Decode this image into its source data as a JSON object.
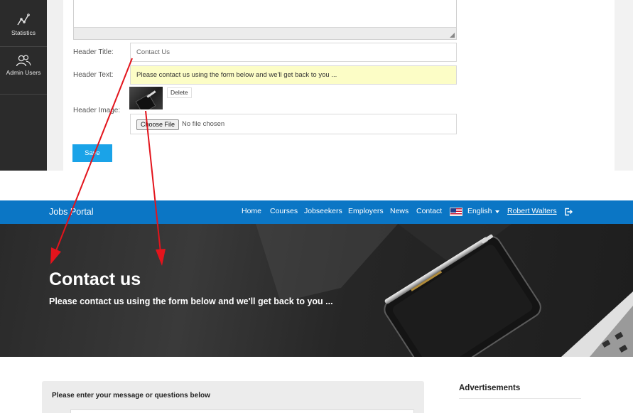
{
  "admin": {
    "sidebar": {
      "statistics": "Statistics",
      "admin_users": "Admin Users"
    },
    "form": {
      "header_title_label": "Header Title:",
      "header_title_value": "Contact Us",
      "header_text_label": "Header Text:",
      "header_text_value": "Please contact us using the form below and we'll get back to you ...",
      "header_image_label": "Header Image:",
      "delete_label": "Delete",
      "choose_file_label": "Choose File",
      "file_status": "No file chosen",
      "save_label": "Save"
    }
  },
  "site": {
    "brand": "Jobs Portal",
    "nav": [
      "Home",
      "Courses",
      "Jobseekers",
      "Employers",
      "News",
      "Contact"
    ],
    "language": "English",
    "user": "Robert Walters",
    "hero": {
      "title": "Contact us",
      "text": "Please contact us using the form below and we'll get back to you ..."
    },
    "message_card_title": "Please enter your message or questions below",
    "ads_title": "Advertisements"
  },
  "colors": {
    "navbar": "#0b76c5",
    "save_button": "#1aa3e8",
    "annotation_arrow": "#e3141c",
    "highlight_input": "#fcfdc6"
  },
  "icons": [
    "statistics-icon",
    "admin-users-icon",
    "us-flag-icon",
    "caret-down-icon",
    "logout-icon"
  ]
}
